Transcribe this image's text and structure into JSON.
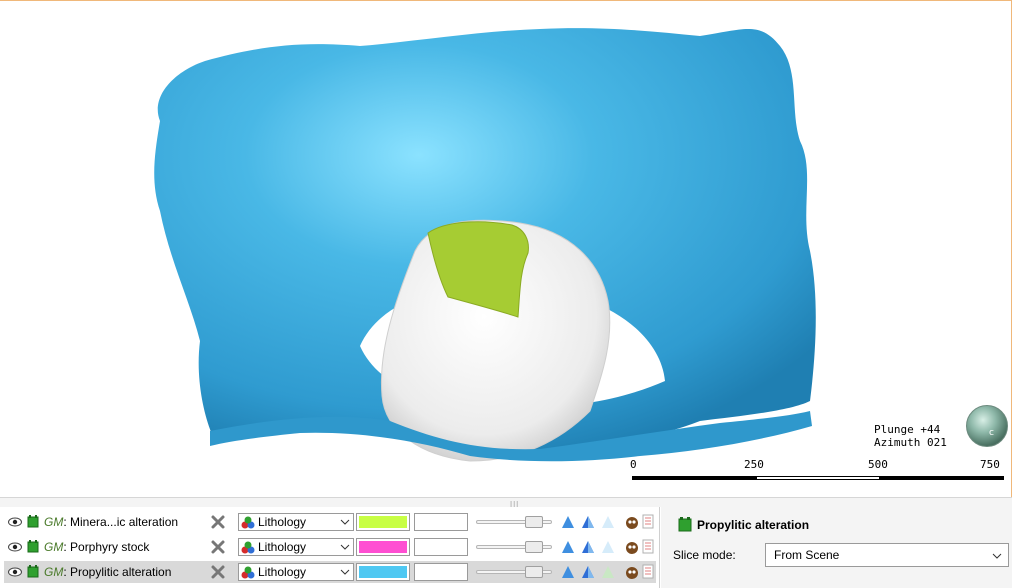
{
  "scene": {
    "orientation": {
      "plunge": "Plunge +44",
      "azimuth": "Azimuth 021"
    },
    "compass_icon": "view-orientation-globe-icon",
    "compass_letter": "c",
    "scale": {
      "labels": [
        "0",
        "250",
        "500",
        "750"
      ]
    },
    "colors": {
      "propylitic": "#3aa8dc",
      "stock": "#f2f2f2",
      "mineralized": "#a6cc33"
    }
  },
  "layers": {
    "rows": [
      {
        "prefix": "GM",
        "name": ": Minera...ic alteration",
        "colour_by": "Lithology",
        "swatch": "#c8ff44",
        "slider": 0.85,
        "selected": false
      },
      {
        "prefix": "GM",
        "name": ": Porphyry stock",
        "colour_by": "Lithology",
        "swatch": "#ff4fd2",
        "slider": 0.85,
        "selected": false
      },
      {
        "prefix": "GM",
        "name": ": Propylitic alteration",
        "colour_by": "Lithology",
        "swatch": "#4fc8f2",
        "slider": 0.85,
        "selected": true
      }
    ]
  },
  "properties": {
    "title": "Propylitic alteration",
    "slice_mode_label": "Slice mode:",
    "slice_mode_value": "From Scene"
  }
}
